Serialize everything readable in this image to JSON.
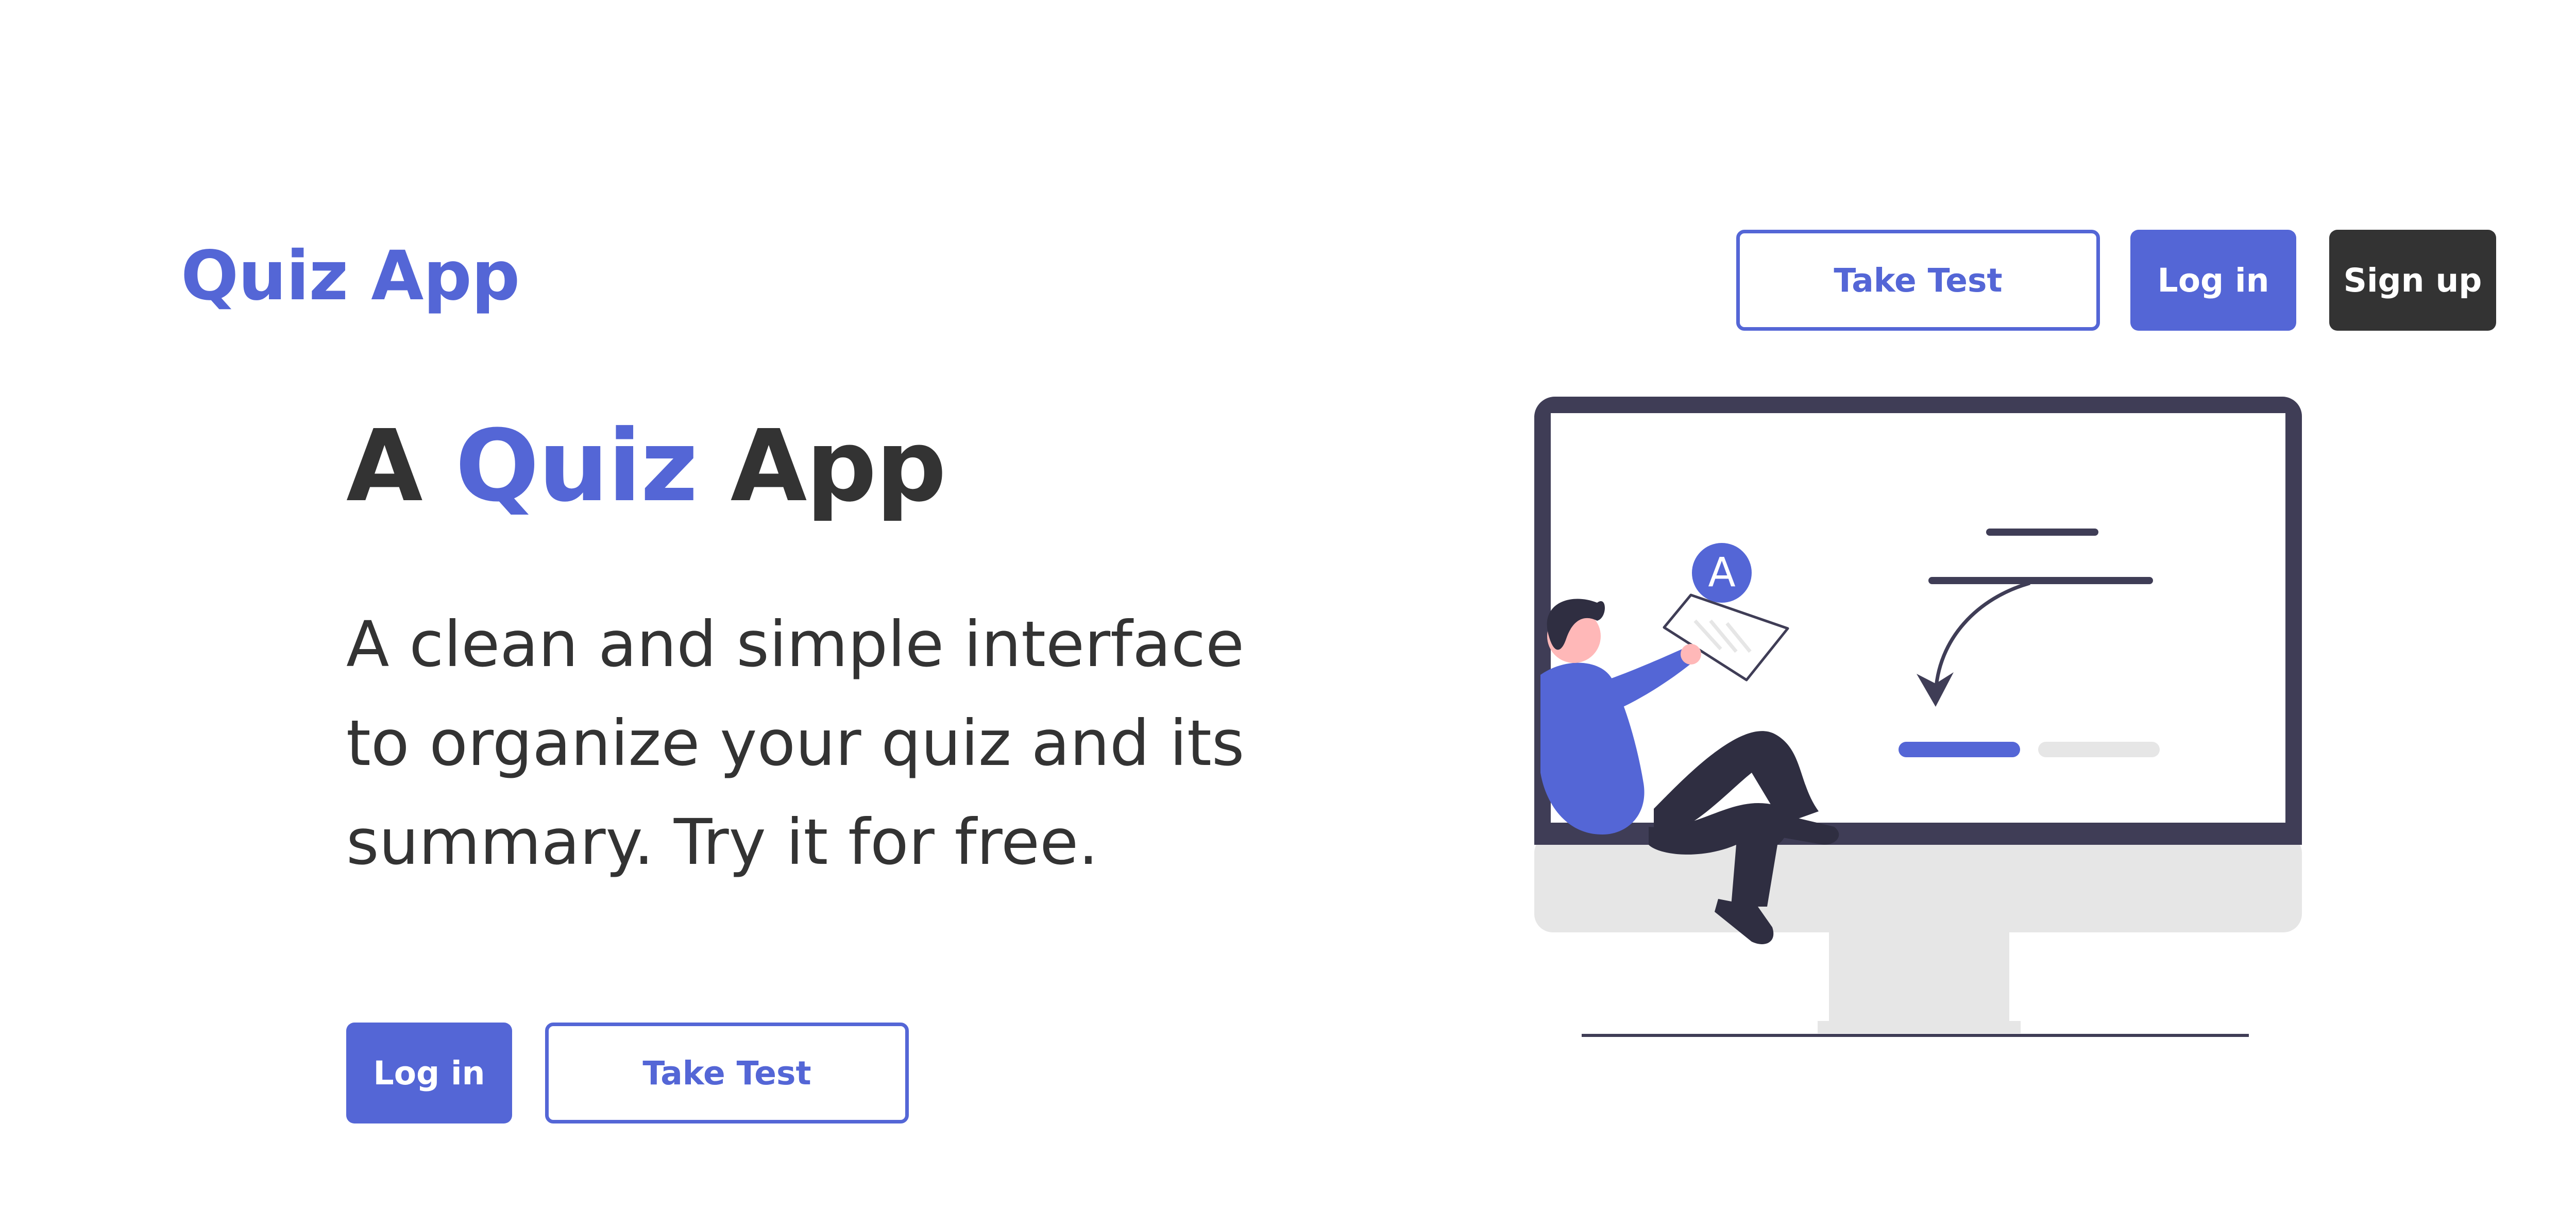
{
  "header": {
    "brand": "Quiz App",
    "nav": {
      "take_test_label": "Take Test",
      "login_label": "Log in",
      "signup_label": "Sign up"
    }
  },
  "hero": {
    "title_prefix": "A ",
    "title_accent": "Quiz",
    "title_suffix": " App",
    "description": "A clean and simple interface to organize your quiz and its summary. Try it for free.",
    "login_label": "Log in",
    "take_test_label": "Take Test"
  },
  "illustration": {
    "badge_letter": "A",
    "icon": "quiz-illustration"
  },
  "colors": {
    "accent": "#5466d6",
    "dark": "#333333",
    "monitor_frame": "#3f3d56",
    "monitor_stand": "#e6e6e6"
  }
}
